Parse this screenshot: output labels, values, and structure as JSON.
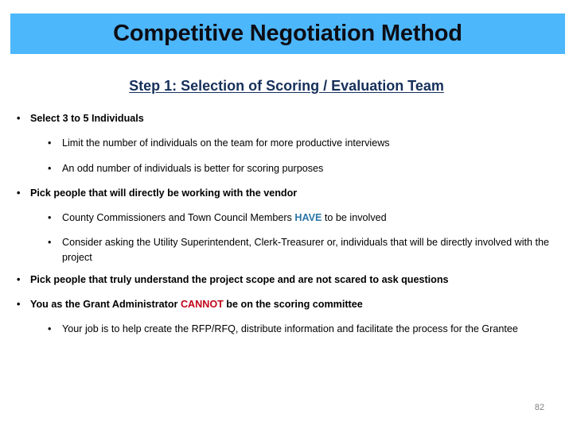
{
  "slide": {
    "title": "Competitive Negotiation Method",
    "subtitle": "Step 1: Selection of Scoring / Evaluation Team",
    "page_number": "82",
    "bullet_glyph": "•",
    "colors": {
      "banner_background": "#4DB7FC",
      "title_text": "#0D0D14",
      "subtitle_text": "#16305B",
      "emphasis_blue": "#2A76A8",
      "emphasis_red": "#C00418",
      "body_text": "#000000",
      "page_number_text": "#808080"
    },
    "bullets": [
      {
        "level": 1,
        "text": "Select 3 to 5 Individuals"
      },
      {
        "level": 2,
        "text": "Limit the number of individuals on the team for more productive interviews"
      },
      {
        "level": 2,
        "text": "An odd number of individuals is better for scoring purposes"
      },
      {
        "level": 1,
        "text": "Pick people that will directly be working with the vendor"
      },
      {
        "level": 2,
        "text_before": "County Commissioners and Town Council Members ",
        "emphasis": "HAVE",
        "emphasis_color": "blue",
        "text_after": " to be involved"
      },
      {
        "level": 2,
        "text": "Consider asking the Utility Superintendent, Clerk-Treasurer or, individuals that will be directly involved with the project"
      },
      {
        "level": 1,
        "text": "Pick people that truly understand the project scope and are not scared to ask questions"
      },
      {
        "level": 1,
        "text_before": "You as the Grant Administrator ",
        "emphasis": "CANNOT",
        "emphasis_color": "red",
        "text_after": " be on the scoring committee"
      },
      {
        "level": 2,
        "justified": true,
        "text": "Your job is to help create the RFP/RFQ, distribute information and facilitate the process for the Grantee"
      }
    ]
  }
}
